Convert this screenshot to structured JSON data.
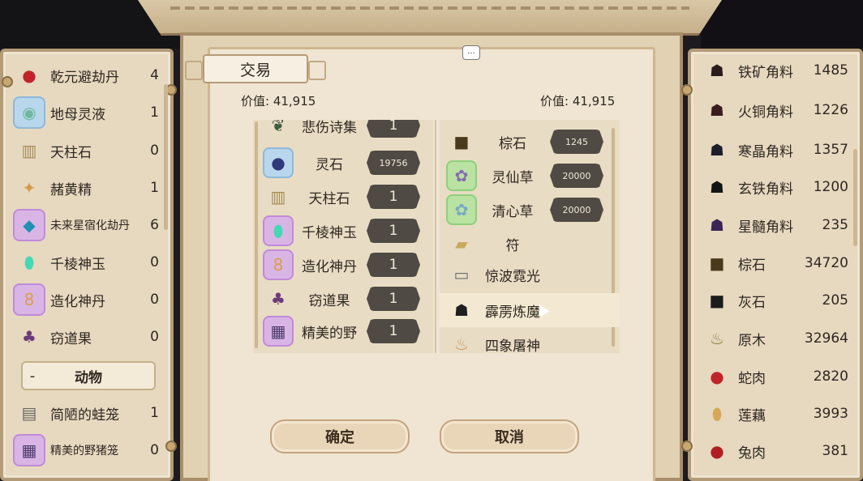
{
  "dialog": {
    "title": "交易",
    "chat_icon": "...",
    "value_left": "价值: 41,915",
    "value_right": "价值: 41,915",
    "confirm_label": "确定",
    "cancel_label": "取消"
  },
  "left_inventory": {
    "items": [
      {
        "name": "乾元避劫丹",
        "count": "4",
        "icon": "red-pill-icon",
        "rarity": "none"
      },
      {
        "name": "地母灵液",
        "count": "1",
        "icon": "green-jade-icon",
        "rarity": "blue"
      },
      {
        "name": "天柱石",
        "count": "0",
        "icon": "stone-pillar-icon",
        "rarity": "none"
      },
      {
        "name": "赭黄精",
        "count": "1",
        "icon": "root-icon",
        "rarity": "none"
      },
      {
        "name": "未来星宿化劫丹",
        "count": "6",
        "icon": "star-pill-icon",
        "rarity": "purple"
      },
      {
        "name": "千棱神玉",
        "count": "0",
        "icon": "jade-icon",
        "rarity": "none"
      },
      {
        "name": "造化神丹",
        "count": "0",
        "icon": "gourd-icon",
        "rarity": "purple"
      },
      {
        "name": "窃道果",
        "count": "0",
        "icon": "fruit-icon",
        "rarity": "none"
      }
    ],
    "category": {
      "toggle": "-",
      "label": "动物"
    },
    "animal_items": [
      {
        "name": "简陋的蛙笼",
        "count": "1",
        "icon": "cage-icon",
        "rarity": "none"
      },
      {
        "name": "精美的野猪笼",
        "count": "0",
        "icon": "fancy-cage-icon",
        "rarity": "purple"
      }
    ]
  },
  "trade_left": {
    "items": [
      {
        "name": "悲伤诗集",
        "qty": "1",
        "icon": "book-icon",
        "rarity": "none"
      },
      {
        "name": "灵石",
        "qty": "19756",
        "icon": "spirit-stone-icon",
        "rarity": "blue"
      },
      {
        "name": "天柱石",
        "qty": "1",
        "icon": "stone-pillar-icon",
        "rarity": "none"
      },
      {
        "name": "千棱神玉",
        "qty": "1",
        "icon": "jade-icon",
        "rarity": "purple"
      },
      {
        "name": "造化神丹",
        "qty": "1",
        "icon": "gourd-icon",
        "rarity": "purple"
      },
      {
        "name": "窃道果",
        "qty": "1",
        "icon": "fruit-icon",
        "rarity": "none"
      },
      {
        "name": "精美的野",
        "qty": "1",
        "icon": "fancy-cage-icon",
        "rarity": "purple"
      }
    ]
  },
  "trade_right": {
    "items": [
      {
        "name": "棕石",
        "qty": "1245",
        "icon": "brown-stone-icon",
        "rarity": "none"
      },
      {
        "name": "灵仙草",
        "qty": "20000",
        "icon": "herb-icon",
        "rarity": "green"
      },
      {
        "name": "清心草",
        "qty": "20000",
        "icon": "herb-icon",
        "rarity": "green"
      },
      {
        "name": "符",
        "qty": "",
        "icon": "talisman-icon",
        "rarity": "none"
      },
      {
        "name": "惊波霓光",
        "qty": "",
        "icon": "scroll-box-icon",
        "rarity": "none"
      },
      {
        "name": "霹雳炼魔",
        "qty": "",
        "icon": "coal-icon",
        "rarity": "none"
      },
      {
        "name": "四象屠神",
        "qty": "",
        "icon": "wood-icon",
        "rarity": "none"
      }
    ]
  },
  "right_inventory": {
    "items": [
      {
        "name": "铁矿角料",
        "count": "1485",
        "icon": "ore-icon"
      },
      {
        "name": "火铜角料",
        "count": "1226",
        "icon": "ore-icon"
      },
      {
        "name": "寒晶角料",
        "count": "1357",
        "icon": "ore-icon"
      },
      {
        "name": "玄铁角料",
        "count": "1200",
        "icon": "ore-icon"
      },
      {
        "name": "星髓角料",
        "count": "235",
        "icon": "ore-icon"
      },
      {
        "name": "棕石",
        "count": "34720",
        "icon": "brown-stone-icon"
      },
      {
        "name": "灰石",
        "count": "205",
        "icon": "grey-stone-icon"
      },
      {
        "name": "原木",
        "count": "32964",
        "icon": "wood-icon"
      },
      {
        "name": "蛇肉",
        "count": "2820",
        "icon": "meat-icon"
      },
      {
        "name": "莲藕",
        "count": "3993",
        "icon": "lotus-root-icon"
      },
      {
        "name": "兔肉",
        "count": "381",
        "icon": "meat-icon"
      }
    ]
  }
}
